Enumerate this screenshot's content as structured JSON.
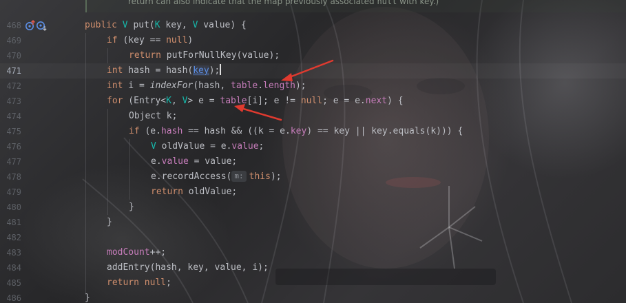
{
  "doc_comment": {
    "prefix": "return can also indicate that the map previously associated ",
    "code": "null",
    "suffix": " with key.)"
  },
  "gutter": {
    "line_numbers": [
      "468",
      "469",
      "470",
      "471",
      "472",
      "473",
      "474",
      "475",
      "476",
      "477",
      "478",
      "479",
      "480",
      "481",
      "482",
      "483",
      "484",
      "485",
      "486"
    ],
    "current_line": "471",
    "icons": [
      "override-up-icon",
      "recursion-icon"
    ]
  },
  "code": {
    "l468": {
      "t1": "public ",
      "t2": "V",
      "t3": " put(",
      "t4": "K",
      "t5": " key, ",
      "t6": "V",
      "t7": " value) {"
    },
    "l469": {
      "t1": "if",
      "t2": " (key == ",
      "t3": "null",
      "t4": ")"
    },
    "l470": {
      "t1": "return",
      "t2": " putForNullKey(value);"
    },
    "l471": {
      "t1": "int",
      "t2": " hash = hash(",
      "t3": "key",
      "t4": ");"
    },
    "l472": {
      "t1": "int",
      "t2": " i = ",
      "t3": "indexFor",
      "t4": "(hash, ",
      "t5": "table",
      "t6": ".",
      "t7": "length",
      "t8": ");"
    },
    "l473": {
      "t1": "for",
      "t2": " (Entry<",
      "t3": "K",
      "t4": ", ",
      "t5": "V",
      "t6": "> e = ",
      "t7": "table",
      "t8": "[i]; e != ",
      "t9": "null",
      "t10": "; e = e.",
      "t11": "next",
      "t12": ") {"
    },
    "l474": {
      "t1": "Object k;"
    },
    "l475": {
      "t1": "if",
      "t2": " (e.",
      "t3": "hash",
      "t4": " == hash && ((k = e.",
      "t5": "key",
      "t6": ") == key || key.equals(k))) {"
    },
    "l476": {
      "t1": "V",
      "t2": " oldValue = e.",
      "t3": "value",
      "t4": ";"
    },
    "l477": {
      "t1": "e.",
      "t2": "value",
      "t3": " = value;"
    },
    "l478": {
      "t1": "e.recordAccess(",
      "t2": "m:",
      "t3": "this",
      "t4": ");"
    },
    "l479": {
      "t1": "return",
      "t2": " oldValue;"
    },
    "l480": {
      "t1": "}"
    },
    "l481": {
      "t1": "}"
    },
    "l483": {
      "t1": "modCount",
      "t2": "++;"
    },
    "l484": {
      "t1": "addEntry(hash, key, value, i);"
    },
    "l485": {
      "t1": "return",
      "t2": " ",
      "t3": "null",
      "t4": ";"
    },
    "l486": {
      "t1": "}"
    }
  },
  "annotations": {
    "arrow_color": "#e03a2f"
  },
  "colors": {
    "keyword": "#cf8e6d",
    "type_param": "#16baac",
    "field": "#c77dbb",
    "param_highlight": "#5c8fe6",
    "text": "#bcbec4",
    "line_number": "#5d6066"
  }
}
